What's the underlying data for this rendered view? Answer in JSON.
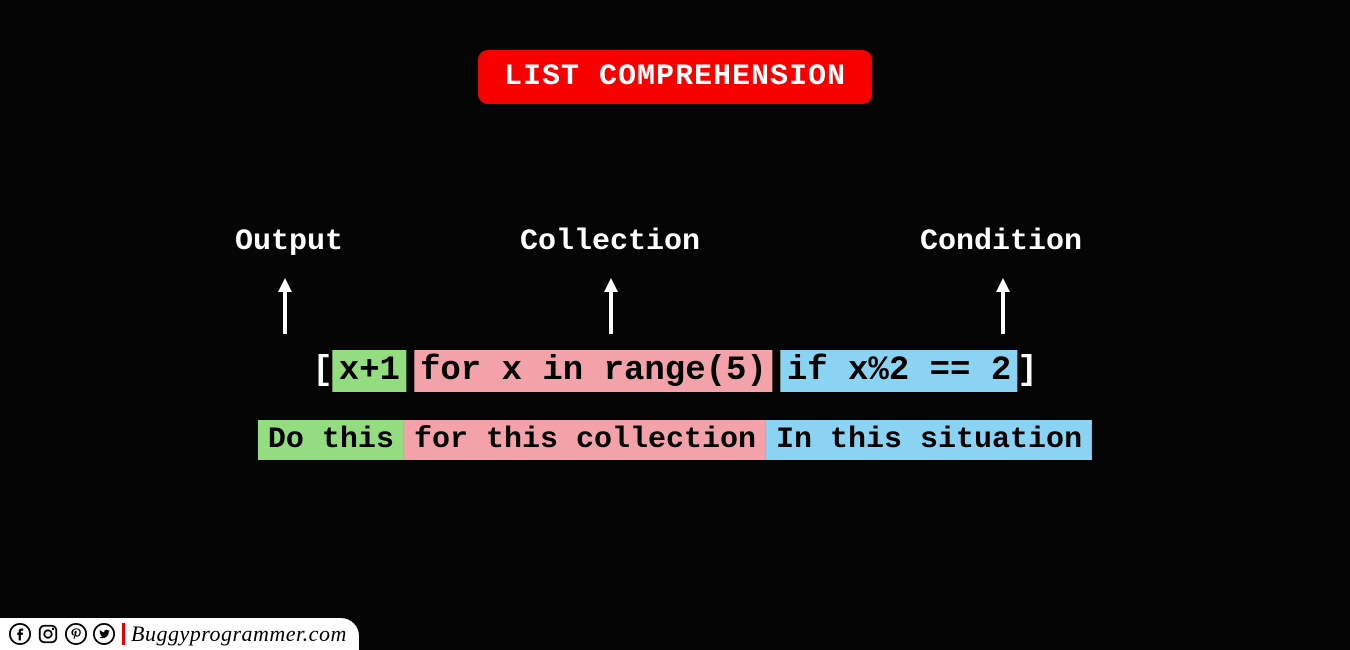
{
  "title": "LIST COMPREHENSION",
  "labels": {
    "output": "Output",
    "collection": "Collection",
    "condition": "Condition"
  },
  "code": {
    "open_bracket": "[",
    "output_expr": "x+1",
    "collection_expr": "for x in range(5)",
    "condition_expr": "if x%2 == 2",
    "close_bracket": "]"
  },
  "desc": {
    "output": "Do this",
    "collection": " for this collection ",
    "condition": "In this situation"
  },
  "footer": {
    "brand": "Buggyprogrammer.com",
    "icons": {
      "facebook": "facebook-icon",
      "instagram": "instagram-icon",
      "pinterest": "pinterest-icon",
      "twitter": "twitter-icon"
    }
  },
  "colors": {
    "bg": "#050505",
    "red": "#f70000",
    "green": "#94dc80",
    "pink": "#f3a2a9",
    "blue": "#8bd3f2"
  }
}
